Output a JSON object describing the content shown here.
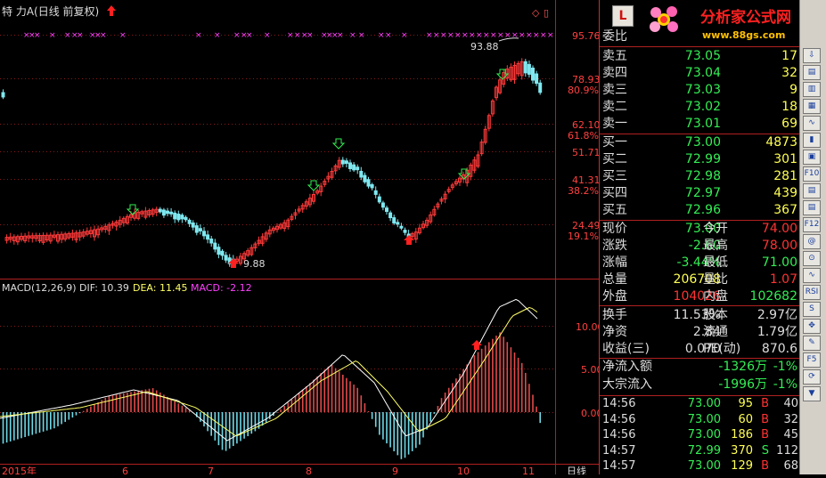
{
  "chart": {
    "title": "特 力A(日线 前复权)",
    "price_labels": [
      "95.76",
      "78.93",
      "62.10",
      "51.71",
      "41.31",
      "24.49"
    ],
    "pct_labels": [
      "80.9%",
      "61.8%",
      "38.2%",
      "19.1%"
    ],
    "high_label": "93.88",
    "low_label": "9.88",
    "macd": {
      "name": "MACD(12,26,9)",
      "dif": "DIF: 10.39",
      "dea": "DEA: 11.45",
      "macd": "MACD: -2.12",
      "axis": [
        "10.00",
        "5.00",
        "0.00"
      ]
    },
    "date_labels": [
      "2015年",
      "6",
      "7",
      "8",
      "9",
      "10",
      "11"
    ],
    "period_label": "日线"
  },
  "header_box": "委比",
  "brand": {
    "name": "分析家公式网",
    "url": "www.88gs.com"
  },
  "orderbook": {
    "asks": [
      {
        "label": "卖五",
        "price": "73.05",
        "vol": "17"
      },
      {
        "label": "卖四",
        "price": "73.04",
        "vol": "32"
      },
      {
        "label": "卖三",
        "price": "73.03",
        "vol": "9"
      },
      {
        "label": "卖二",
        "price": "73.02",
        "vol": "18"
      },
      {
        "label": "卖一",
        "price": "73.01",
        "vol": "69"
      }
    ],
    "bids": [
      {
        "label": "买一",
        "price": "73.00",
        "vol": "4873"
      },
      {
        "label": "买二",
        "price": "72.99",
        "vol": "301"
      },
      {
        "label": "买三",
        "price": "72.98",
        "vol": "281"
      },
      {
        "label": "买四",
        "price": "72.97",
        "vol": "439"
      },
      {
        "label": "买五",
        "price": "72.96",
        "vol": "367"
      }
    ]
  },
  "quote": {
    "rows": [
      {
        "l1": "现价",
        "v1": "73.00",
        "l2": "今开",
        "v2": "74.00"
      },
      {
        "l1": "涨跌",
        "v1": "-2.60",
        "l2": "最高",
        "v2": "78.00"
      },
      {
        "l1": "涨幅",
        "v1": "-3.44%",
        "l2": "最低",
        "v2": "71.00"
      },
      {
        "l1": "总量",
        "v1": "206708",
        "l2": "量比",
        "v2": "1.07"
      },
      {
        "l1": "外盘",
        "v1": "104026",
        "l2": "内盘",
        "v2": "102682"
      }
    ]
  },
  "stats": {
    "rows": [
      {
        "l1": "换手",
        "v1": "11.53%",
        "l2": "股本",
        "v2": "2.97亿"
      },
      {
        "l1": "净资",
        "v1": "2.84",
        "l2": "流通",
        "v2": "1.79亿"
      },
      {
        "l1": "收益(三)",
        "v1": "0.070",
        "l2": "PE(动)",
        "v2": "870.6"
      }
    ]
  },
  "flows": [
    {
      "label": "净流入额",
      "value": "-1326万",
      "pct": "-1%"
    },
    {
      "label": "大宗流入",
      "value": "-1996万",
      "pct": "-1%"
    }
  ],
  "trades": [
    {
      "time": "14:56",
      "price": "73.00",
      "vol": "95",
      "side": "B",
      "count": "40"
    },
    {
      "time": "14:56",
      "price": "73.00",
      "vol": "60",
      "side": "B",
      "count": "32"
    },
    {
      "time": "14:56",
      "price": "73.00",
      "vol": "186",
      "side": "B",
      "count": "45"
    },
    {
      "time": "14:57",
      "price": "72.99",
      "vol": "370",
      "side": "S",
      "count": "112"
    },
    {
      "time": "14:57",
      "price": "73.00",
      "vol": "129",
      "side": "B",
      "count": "68"
    }
  ],
  "toolbar": {
    "l_button": "L",
    "items": [
      "⇩",
      "▤",
      "▥",
      "▦",
      "∿",
      "▮",
      "▣",
      "F10",
      "▤",
      "▤",
      "F12",
      "@",
      "⊙",
      "∿",
      "RSI",
      "S",
      "✥",
      "✎",
      "F5",
      "⟳",
      "▼"
    ]
  }
}
